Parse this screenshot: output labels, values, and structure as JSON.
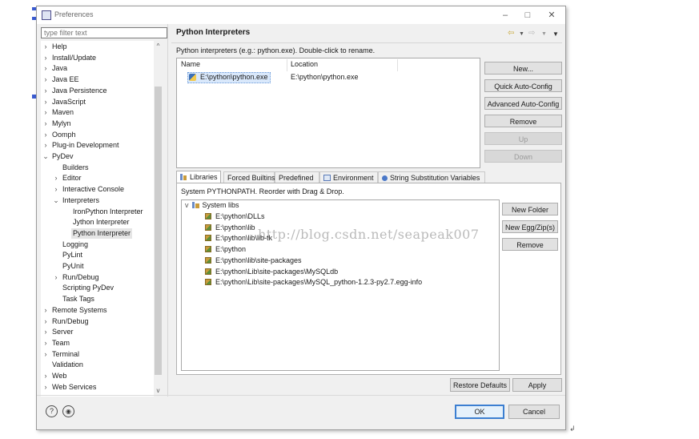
{
  "window": {
    "title": "Preferences"
  },
  "filter": {
    "placeholder": "type filter text"
  },
  "tree": [
    {
      "label": "Help",
      "level": 0,
      "twisty": ">"
    },
    {
      "label": "Install/Update",
      "level": 0,
      "twisty": ">"
    },
    {
      "label": "Java",
      "level": 0,
      "twisty": ">"
    },
    {
      "label": "Java EE",
      "level": 0,
      "twisty": ">"
    },
    {
      "label": "Java Persistence",
      "level": 0,
      "twisty": ">"
    },
    {
      "label": "JavaScript",
      "level": 0,
      "twisty": ">"
    },
    {
      "label": "Maven",
      "level": 0,
      "twisty": ">"
    },
    {
      "label": "Mylyn",
      "level": 0,
      "twisty": ">"
    },
    {
      "label": "Oomph",
      "level": 0,
      "twisty": ">"
    },
    {
      "label": "Plug-in Development",
      "level": 0,
      "twisty": ">"
    },
    {
      "label": "PyDev",
      "level": 0,
      "twisty": "v"
    },
    {
      "label": "Builders",
      "level": 1,
      "twisty": ""
    },
    {
      "label": "Editor",
      "level": 1,
      "twisty": ">"
    },
    {
      "label": "Interactive Console",
      "level": 1,
      "twisty": ">"
    },
    {
      "label": "Interpreters",
      "level": 1,
      "twisty": "v"
    },
    {
      "label": "IronPython Interpreter",
      "level": 2,
      "twisty": ""
    },
    {
      "label": "Jython Interpreter",
      "level": 2,
      "twisty": ""
    },
    {
      "label": "Python Interpreter",
      "level": 2,
      "twisty": "",
      "selected": true
    },
    {
      "label": "Logging",
      "level": 1,
      "twisty": ""
    },
    {
      "label": "PyLint",
      "level": 1,
      "twisty": ""
    },
    {
      "label": "PyUnit",
      "level": 1,
      "twisty": ""
    },
    {
      "label": "Run/Debug",
      "level": 1,
      "twisty": ">"
    },
    {
      "label": "Scripting PyDev",
      "level": 1,
      "twisty": ""
    },
    {
      "label": "Task Tags",
      "level": 1,
      "twisty": ""
    },
    {
      "label": "Remote Systems",
      "level": 0,
      "twisty": ">"
    },
    {
      "label": "Run/Debug",
      "level": 0,
      "twisty": ">"
    },
    {
      "label": "Server",
      "level": 0,
      "twisty": ">"
    },
    {
      "label": "Team",
      "level": 0,
      "twisty": ">"
    },
    {
      "label": "Terminal",
      "level": 0,
      "twisty": ">"
    },
    {
      "label": "Validation",
      "level": 0,
      "twisty": ""
    },
    {
      "label": "Web",
      "level": 0,
      "twisty": ">"
    },
    {
      "label": "Web Services",
      "level": 0,
      "twisty": ">"
    }
  ],
  "page": {
    "title": "Python Interpreters",
    "description": "Python interpreters (e.g.: python.exe).   Double-click to rename."
  },
  "interpreters": {
    "columns": [
      "Name",
      "Location"
    ],
    "rows": [
      {
        "name": "E:\\python\\python.exe",
        "location": "E:\\python\\python.exe"
      }
    ]
  },
  "side_buttons": [
    {
      "label": "New...",
      "enabled": true
    },
    {
      "label": "Quick Auto-Config",
      "enabled": true
    },
    {
      "label": "Advanced Auto-Config",
      "enabled": true
    },
    {
      "label": "Remove",
      "enabled": true
    },
    {
      "label": "Up",
      "enabled": false
    },
    {
      "label": "Down",
      "enabled": false
    }
  ],
  "tabs": [
    "Libraries",
    "Forced Builtins",
    "Predefined",
    "Environment",
    "String Substitution Variables"
  ],
  "libraries": {
    "caption": "System PYTHONPATH.   Reorder with Drag & Drop.",
    "root": "System libs",
    "paths": [
      "E:\\python\\DLLs",
      "E:\\python\\lib",
      "E:\\python\\lib\\lib-tk",
      "E:\\python",
      "E:\\python\\lib\\site-packages",
      "E:\\python\\Lib\\site-packages\\MySQLdb",
      "E:\\python\\Lib\\site-packages\\MySQL_python-1.2.3-py2.7.egg-info"
    ],
    "buttons": [
      "New Folder",
      "New Egg/Zip(s)",
      "Remove"
    ]
  },
  "watermark": "http://blog.csdn.net/seapeak007",
  "footer": {
    "restore_defaults": "Restore Defaults",
    "apply": "Apply",
    "ok": "OK",
    "cancel": "Cancel"
  },
  "colors": {
    "selection": "#d9e8fb",
    "default_button_border": "#3c7fd1"
  }
}
